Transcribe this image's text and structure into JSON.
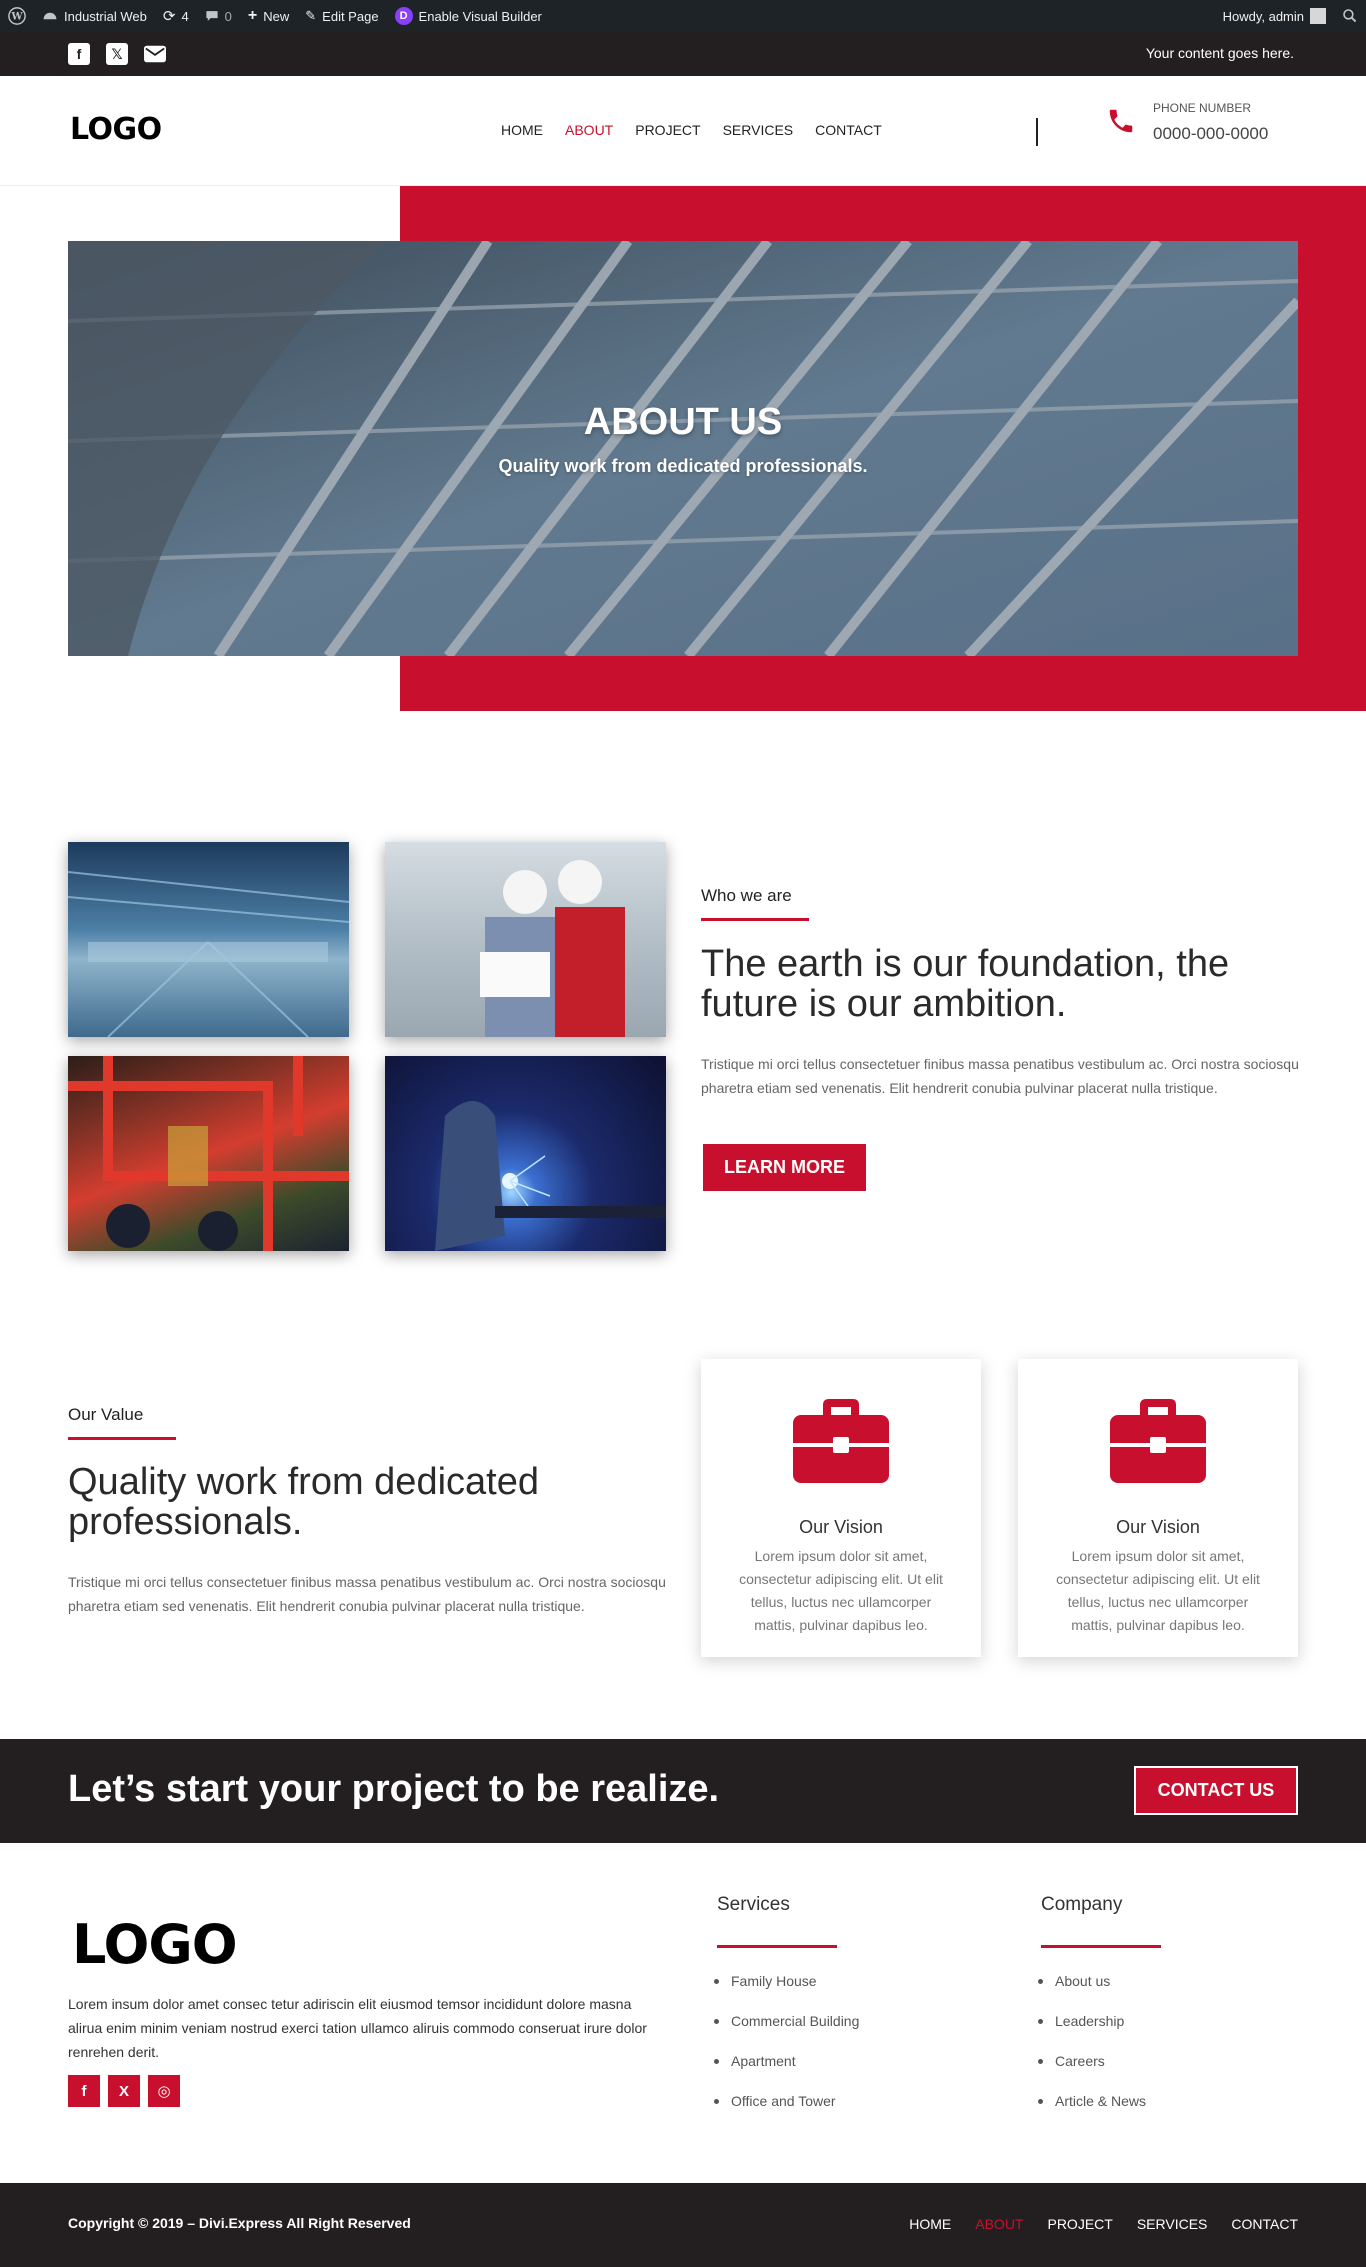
{
  "adminbar": {
    "site_name": "Industrial Web",
    "updates_count": "4",
    "comments_count": "0",
    "new_label": "New",
    "edit_label": "Edit Page",
    "visual_builder_label": "Enable Visual Builder",
    "greeting": "Howdy, admin"
  },
  "topbar": {
    "message": "Your content goes here.",
    "social_icons": [
      "facebook-icon",
      "x-icon",
      "envelope-icon"
    ]
  },
  "header": {
    "logo": "LOGO",
    "nav": [
      "HOME",
      "ABOUT",
      "PROJECT",
      "SERVICES",
      "CONTACT"
    ],
    "active_nav": "ABOUT",
    "phone_label": "PHONE NUMBER",
    "phone_number": "0000-000-0000"
  },
  "hero": {
    "title": "ABOUT US",
    "subtitle": "Quality work from dedicated professionals."
  },
  "who": {
    "eyebrow": "Who we are",
    "heading": "The earth is our foundation, the future is our ambition.",
    "text": "Tristique mi orci tellus consectetuer finibus massa penatibus vestibulum ac. Orci nostra sociosqu pharetra etiam sed venenatis. Elit hendrerit conubia pulvinar placerat nulla tristique.",
    "button": "LEARN MORE"
  },
  "value": {
    "eyebrow": "Our Value",
    "heading": "Quality work from dedicated professionals.",
    "text": "Tristique mi orci tellus consectetuer finibus massa penatibus vestibulum ac. Orci nostra sociosqu pharetra etiam sed venenatis. Elit hendrerit conubia pulvinar placerat nulla tristique.",
    "cards": [
      {
        "title": "Our Vision",
        "text": "Lorem ipsum dolor sit amet, consectetur adipiscing elit. Ut elit tellus, luctus nec ullamcorper mattis, pulvinar dapibus leo."
      },
      {
        "title": "Our Vision",
        "text": "Lorem ipsum dolor sit amet, consectetur adipiscing elit. Ut elit tellus, luctus nec ullamcorper mattis, pulvinar dapibus leo."
      }
    ]
  },
  "cta": {
    "text": "Let’s start your project to be realize.",
    "button": "CONTACT US"
  },
  "footer": {
    "logo": "LOGO",
    "text": "Lorem insum dolor amet consec tetur adiriscin elit eiusmod temsor incididunt dolore masna alirua enim minim veniam nostrud exerci tation ullamco aliruis commodo conseruat irure dolor renrehen derit.",
    "socials": [
      "f",
      "X",
      "◎"
    ],
    "services_title": "Services",
    "services": [
      "Family House",
      "Commercial Building",
      "Apartment",
      "Office and Tower"
    ],
    "company_title": "Company",
    "company": [
      "About us",
      "Leadership",
      "Careers",
      "Article & News"
    ],
    "copyright": "Copyright © 2019 – Divi.Express All Right Reserved",
    "nav": [
      "HOME",
      "ABOUT",
      "PROJECT",
      "SERVICES",
      "CONTACT"
    ]
  },
  "colors": {
    "accent": "#c8102e",
    "dark": "#231f20",
    "adminbar": "#1d2327"
  }
}
